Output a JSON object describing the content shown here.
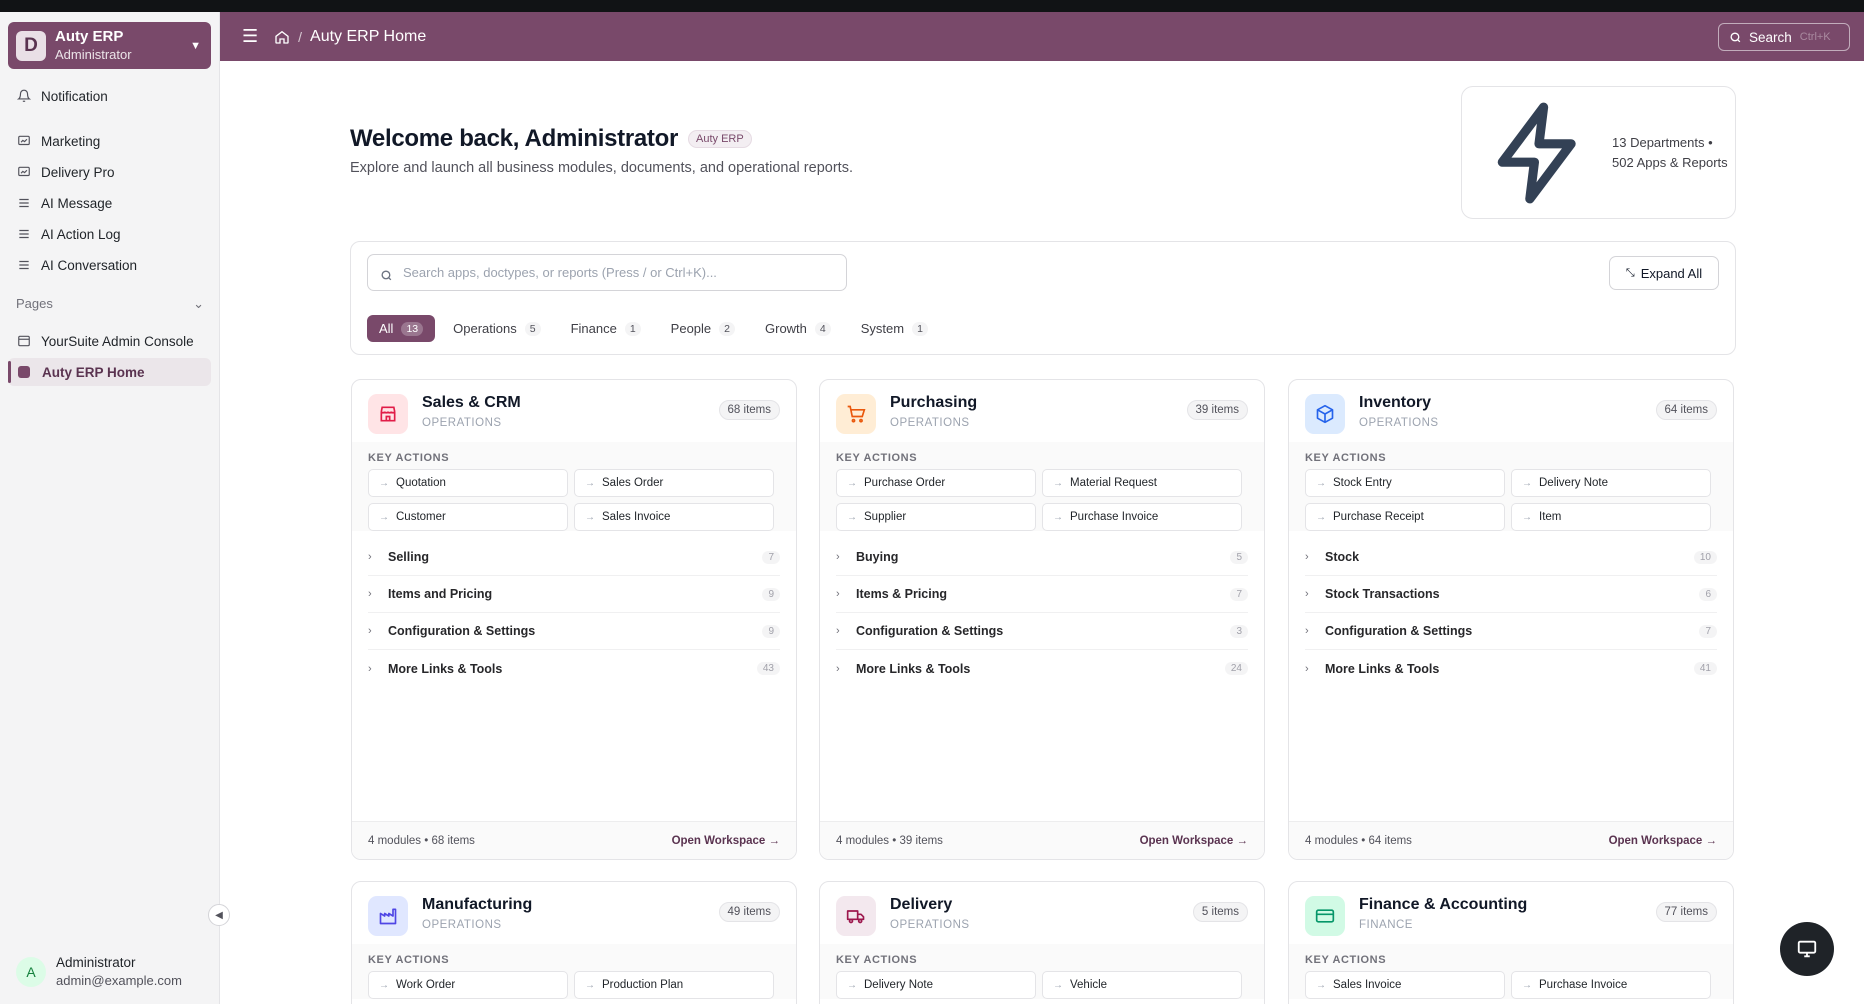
{
  "workspace": {
    "initial": "D",
    "name": "Auty ERP",
    "role": "Administrator"
  },
  "sidebar": {
    "top_items": [
      {
        "label": "Notification"
      },
      {
        "label": "Marketing"
      },
      {
        "label": "Delivery Pro"
      },
      {
        "label": "AI Message"
      },
      {
        "label": "AI Action Log"
      },
      {
        "label": "AI Conversation"
      }
    ],
    "section_label": "Pages",
    "pages": [
      {
        "label": "YourSuite Admin Console"
      },
      {
        "label": "Auty ERP Home"
      }
    ],
    "user": {
      "initial": "A",
      "name": "Administrator",
      "email": "admin@example.com"
    }
  },
  "header": {
    "breadcrumb_sep": "/",
    "title": "Auty ERP Home",
    "search_label": "Search",
    "search_kbd": "Ctrl+K"
  },
  "welcome": {
    "title": "Welcome back, Administrator",
    "badge": "Auty ERP",
    "subtitle": "Explore and launch all business modules, documents, and operational reports."
  },
  "stats": {
    "text": "13 Departments • 502 Apps & Reports"
  },
  "filter": {
    "search_placeholder": "Search apps, doctypes, or reports (Press / or Ctrl+K)...",
    "expand_label": "Expand All",
    "chips": [
      {
        "label": "All",
        "count": "13"
      },
      {
        "label": "Operations",
        "count": "5"
      },
      {
        "label": "Finance",
        "count": "1"
      },
      {
        "label": "People",
        "count": "2"
      },
      {
        "label": "Growth",
        "count": "4"
      },
      {
        "label": "System",
        "count": "1"
      }
    ]
  },
  "key_actions_label": "KEY ACTIONS",
  "cards": [
    {
      "title": "Sales & CRM",
      "category": "OPERATIONS",
      "count": "68 items",
      "icon": "store-icon",
      "icon_color": "#e11d48",
      "icon_bg": "#ffe4e6",
      "actions": [
        "Quotation",
        "Sales Order",
        "Customer",
        "Sales Invoice"
      ],
      "modules": [
        {
          "label": "Selling",
          "count": "7"
        },
        {
          "label": "Items and Pricing",
          "count": "9"
        },
        {
          "label": "Configuration & Settings",
          "count": "9"
        },
        {
          "label": "More Links & Tools",
          "count": "43"
        }
      ],
      "footer": "4 modules • 68 items",
      "open_label": "Open Workspace →"
    },
    {
      "title": "Purchasing",
      "category": "OPERATIONS",
      "count": "39 items",
      "icon": "cart-icon",
      "icon_color": "#ea580c",
      "icon_bg": "#ffedd5",
      "actions": [
        "Purchase Order",
        "Material Request",
        "Supplier",
        "Purchase Invoice"
      ],
      "modules": [
        {
          "label": "Buying",
          "count": "5"
        },
        {
          "label": "Items & Pricing",
          "count": "7"
        },
        {
          "label": "Configuration & Settings",
          "count": "3"
        },
        {
          "label": "More Links & Tools",
          "count": "24"
        }
      ],
      "footer": "4 modules • 39 items",
      "open_label": "Open Workspace →"
    },
    {
      "title": "Inventory",
      "category": "OPERATIONS",
      "count": "64 items",
      "icon": "box-icon",
      "icon_color": "#2563eb",
      "icon_bg": "#dbeafe",
      "actions": [
        "Stock Entry",
        "Delivery Note",
        "Purchase Receipt",
        "Item"
      ],
      "modules": [
        {
          "label": "Stock",
          "count": "10"
        },
        {
          "label": "Stock Transactions",
          "count": "6"
        },
        {
          "label": "Configuration & Settings",
          "count": "7"
        },
        {
          "label": "More Links & Tools",
          "count": "41"
        }
      ],
      "footer": "4 modules • 64 items",
      "open_label": "Open Workspace →"
    },
    {
      "title": "Manufacturing",
      "category": "OPERATIONS",
      "count": "49 items",
      "icon": "factory-icon",
      "icon_color": "#4f46e5",
      "icon_bg": "#e0e7ff",
      "actions": [
        "Work Order",
        "Production Plan"
      ],
      "modules": [],
      "footer": "",
      "open_label": ""
    },
    {
      "title": "Delivery",
      "category": "OPERATIONS",
      "count": "5 items",
      "icon": "truck-icon",
      "icon_color": "#9d174d",
      "icon_bg": "#f3e8ee",
      "actions": [
        "Delivery Note",
        "Vehicle"
      ],
      "modules": [],
      "footer": "",
      "open_label": ""
    },
    {
      "title": "Finance & Accounting",
      "category": "FINANCE",
      "count": "77 items",
      "icon": "card-icon",
      "icon_color": "#059669",
      "icon_bg": "#d1fae5",
      "actions": [
        "Sales Invoice",
        "Purchase Invoice"
      ],
      "modules": [],
      "footer": "",
      "open_label": ""
    }
  ]
}
